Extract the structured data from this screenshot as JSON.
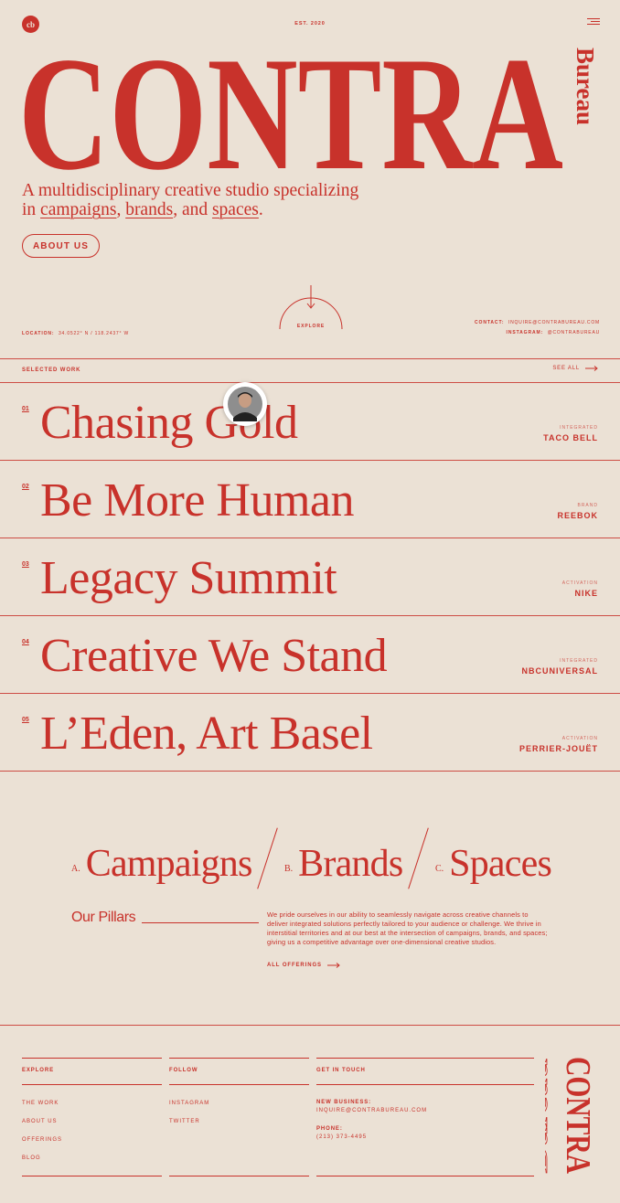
{
  "header": {
    "logo_text": "cb",
    "est": "EST. 2020",
    "wordmark": "CONTRA",
    "wordmark_side": "Bureau"
  },
  "intro": {
    "tagline_prefix": "A multidisciplinary creative studio specializing in ",
    "link_campaigns": "campaigns",
    "sep1": ", ",
    "link_brands": "brands",
    "sep2": ", and ",
    "link_spaces": "spaces",
    "suffix": ".",
    "about_button": "ABOUT US"
  },
  "info_bar": {
    "location_label": "LOCATION:",
    "location_value": "34.0522° N / 118.2437° W",
    "explore_label": "EXPLORE",
    "contact_label": "CONTACT:",
    "contact_value": "INQUIRE@CONTRABUREAU.COM",
    "instagram_label": "INSTAGRAM:",
    "instagram_value": "@CONTRABUREAU"
  },
  "selected_work": {
    "heading": "SELECTED WORK",
    "see_all": "SEE ALL",
    "items": [
      {
        "num": "01",
        "title": "Chasing Gold",
        "category": "INTEGRATED",
        "client": "TACO BELL"
      },
      {
        "num": "02",
        "title": "Be More Human",
        "category": "BRAND",
        "client": "REEBOK"
      },
      {
        "num": "03",
        "title": "Legacy Summit",
        "category": "ACTIVATION",
        "client": "NIKE"
      },
      {
        "num": "04",
        "title": "Creative We Stand",
        "category": "INTEGRATED",
        "client": "NBCUNIVERSAL"
      },
      {
        "num": "05",
        "title": "L’Eden, Art Basel",
        "category": "ACTIVATION",
        "client": "PERRIER-JOUËT"
      }
    ]
  },
  "pillars": {
    "items": [
      {
        "letter": "A.",
        "label": "Campaigns"
      },
      {
        "letter": "B.",
        "label": "Brands"
      },
      {
        "letter": "C.",
        "label": "Spaces"
      }
    ],
    "heading": "Our Pillars",
    "description": "We pride ourselves in our ability to seamlessly navigate across creative channels to deliver integrated solutions perfectly tailored to your audience or challenge. We thrive in interstitial territories and at our best at the intersection of campaigns, brands, and spaces; giving us a competitive advantage over one-dimensional creative studios.",
    "all_offerings": "ALL OFFERINGS"
  },
  "footer": {
    "explore_heading": "EXPLORE",
    "explore_links": [
      "THE WORK",
      "ABOUT US",
      "OFFERINGS",
      "BLOG"
    ],
    "follow_heading": "FOLLOW",
    "follow_links": [
      "INSTAGRAM",
      "TWITTER"
    ],
    "contact_heading": "GET IN TOUCH",
    "new_business_label": "NEW BUSINESS:",
    "new_business_value": "INQUIRE@CONTRABUREAU.COM",
    "phone_label": "PHONE:",
    "phone_value": "(213) 373-4495",
    "logo_word": "CONTRA",
    "logo_side": "Bureau"
  },
  "colors": {
    "background": "#ebe1d5",
    "accent": "#c8322b"
  }
}
